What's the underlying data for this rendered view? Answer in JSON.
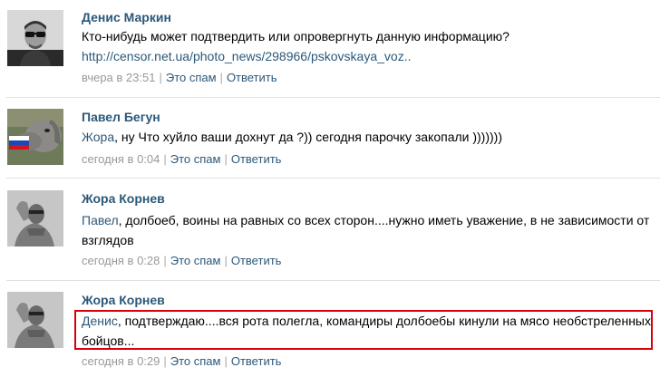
{
  "comments": [
    {
      "author": "Денис Маркин",
      "text": "Кто-нибудь может подтвердить или опровергнуть данную информацию?",
      "link": "http://censor.net.ua/photo_news/298966/pskovskaya_voz..",
      "time": "вчера в 23:51",
      "spam_label": "Это спам",
      "reply_label": "Ответить"
    },
    {
      "author": "Павел Бегун",
      "mention": "Жора",
      "text": ", ну Что хуйло ваши дохнут да ?)) сегодня парочку закопали )))))))",
      "time": "сегодня в 0:04",
      "spam_label": "Это спам",
      "reply_label": "Ответить"
    },
    {
      "author": "Жора Корнев",
      "mention": "Павел",
      "text": ", долбоеб, воины на равных со всех сторон....нужно иметь уважение, в не зависимости от взглядов",
      "time": "сегодня в 0:28",
      "spam_label": "Это спам",
      "reply_label": "Ответить"
    },
    {
      "author": "Жора Корнев",
      "mention": "Денис",
      "text": ", подтверждаю....вся рота полегла, командиры долбоебы кинули на мясо необстреленных бойцов...",
      "time": "сегодня в 0:29",
      "spam_label": "Это спам",
      "reply_label": "Ответить"
    }
  ],
  "colors": {
    "link": "#2b587a",
    "meta": "#999999",
    "separator": "#dae1e8",
    "highlight": "#d9000b"
  },
  "icons": [
    "avatar-man-sunglasses",
    "avatar-dog-flag",
    "avatar-shirtless-man",
    "avatar-shirtless-man"
  ]
}
